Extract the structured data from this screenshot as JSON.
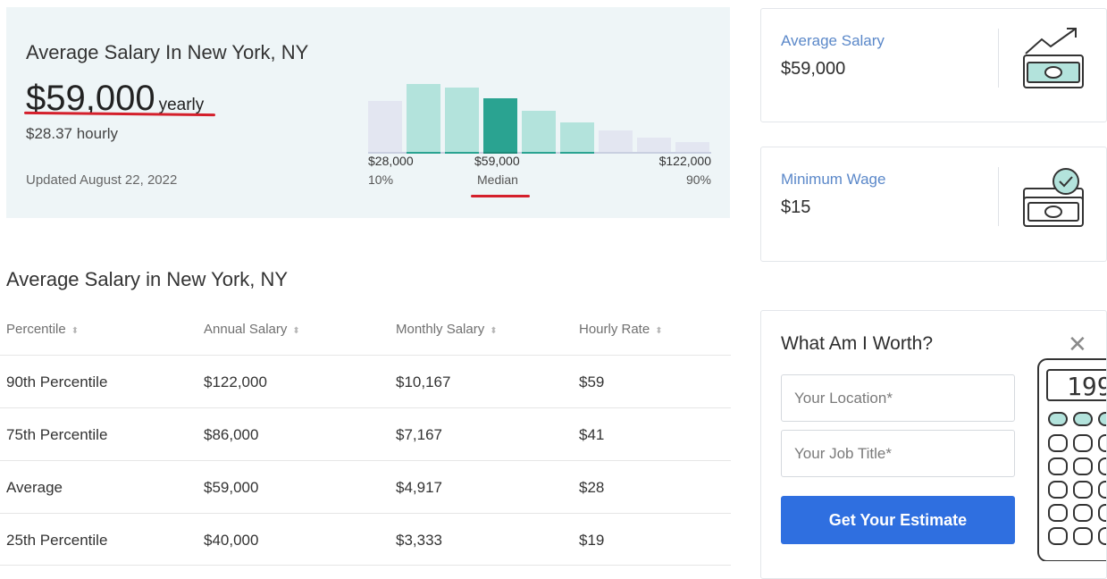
{
  "summary": {
    "title": "Average Salary In New York, NY",
    "amount": "$59,000",
    "period": "yearly",
    "hourly": "$28.37 hourly",
    "updated": "Updated August 22, 2022",
    "histogram": {
      "bars": [
        0.55,
        0.73,
        0.69,
        0.58,
        0.45,
        0.33,
        0.24,
        0.17,
        0.12
      ],
      "median_index": 3,
      "low_value": "$28,000",
      "low_label": "10%",
      "mid_value": "$59,000",
      "mid_label": "Median",
      "high_value": "$122,000",
      "high_label": "90%"
    }
  },
  "cards": {
    "average": {
      "label": "Average Salary",
      "value": "$59,000",
      "icon": "money-growth-icon"
    },
    "minimum": {
      "label": "Minimum Wage",
      "value": "$15",
      "icon": "money-check-icon"
    }
  },
  "table": {
    "title": "Average Salary in New York, NY",
    "headers": [
      "Percentile",
      "Annual Salary",
      "Monthly Salary",
      "Hourly Rate"
    ],
    "rows": [
      [
        "90th Percentile",
        "$122,000",
        "$10,167",
        "$59"
      ],
      [
        "75th Percentile",
        "$86,000",
        "$7,167",
        "$41"
      ],
      [
        "Average",
        "$59,000",
        "$4,917",
        "$28"
      ],
      [
        "25th Percentile",
        "$40,000",
        "$3,333",
        "$19"
      ]
    ]
  },
  "worth": {
    "title": "What Am I Worth?",
    "location_placeholder": "Your Location*",
    "job_placeholder": "Your Job Title*",
    "button": "Get Your Estimate",
    "close_icon": "close-icon",
    "calculator_display": "199"
  },
  "colors": {
    "accent_teal": "#2aa391",
    "light_teal": "#b3e3dc",
    "muted_bar": "#e3e6f1",
    "brand_blue": "#2f6fe0",
    "link_blue": "#5b88c9",
    "highlight_red": "#d41f2b"
  }
}
